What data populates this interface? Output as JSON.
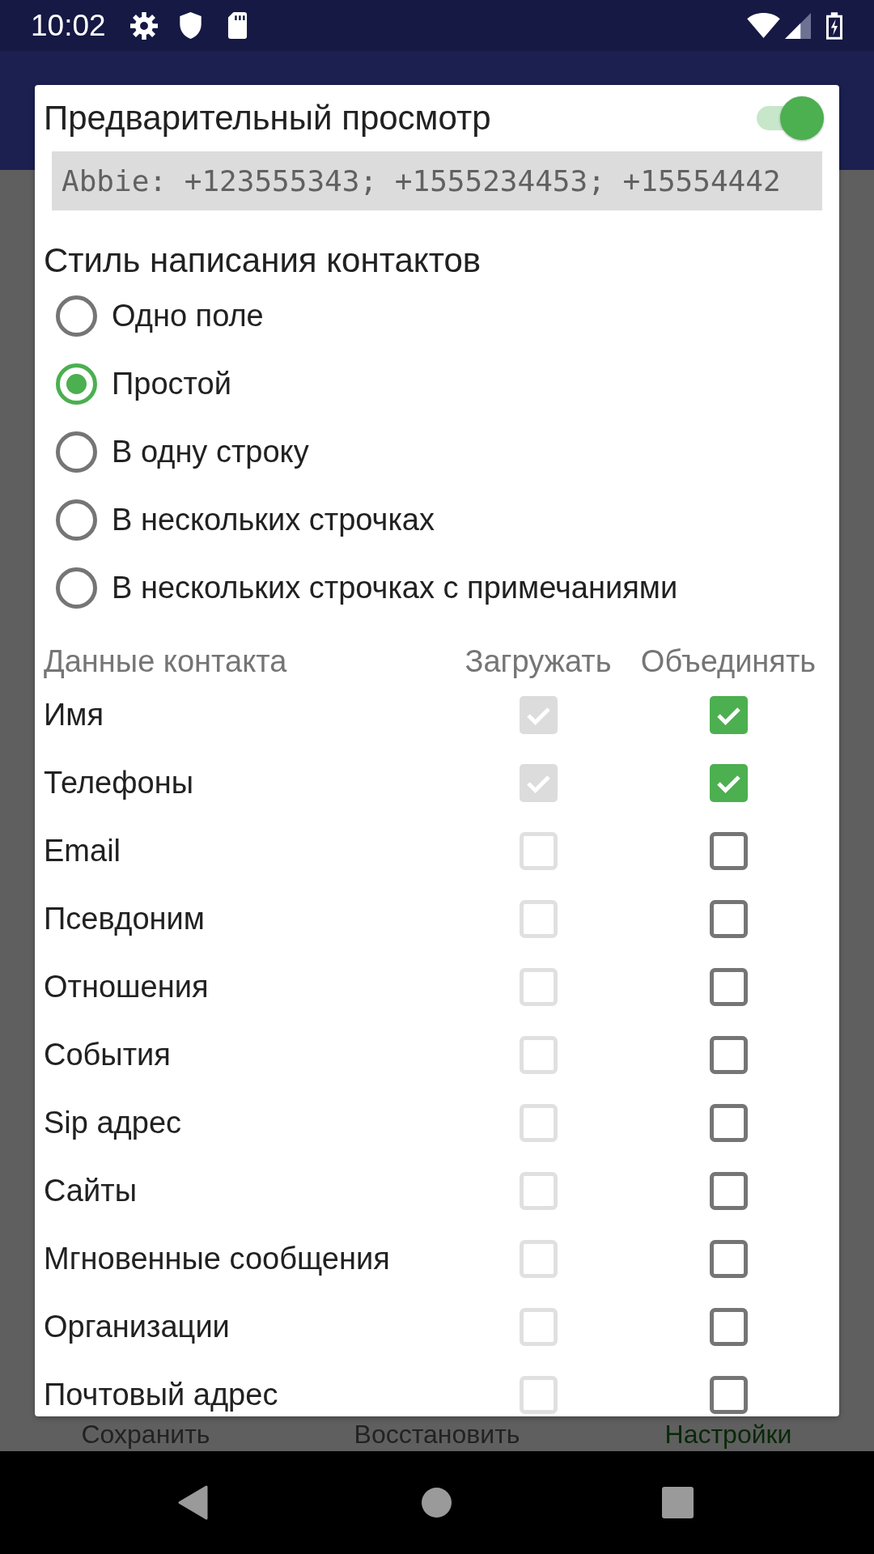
{
  "status_bar": {
    "time": "10:02"
  },
  "dialog": {
    "preview": {
      "title": "Предварительный просмотр",
      "on": true,
      "sample": "Abbie: +123555343; +1555234453; +15554442"
    },
    "style": {
      "title": "Стиль написания контактов",
      "options": [
        {
          "label": "Одно поле",
          "selected": false
        },
        {
          "label": "Простой",
          "selected": true
        },
        {
          "label": "В одну строку",
          "selected": false
        },
        {
          "label": "В нескольких строчках",
          "selected": false
        },
        {
          "label": "В нескольких строчках с примечаниями",
          "selected": false
        }
      ]
    },
    "fields": {
      "columns": [
        "Данные контакта",
        "Загружать",
        "Объединять"
      ],
      "rows": [
        {
          "name": "Имя",
          "load": {
            "checked": true,
            "disabled": true
          },
          "merge": {
            "checked": true,
            "disabled": false
          }
        },
        {
          "name": "Телефоны",
          "load": {
            "checked": true,
            "disabled": true
          },
          "merge": {
            "checked": true,
            "disabled": false
          }
        },
        {
          "name": "Email",
          "load": {
            "checked": false,
            "disabled": true
          },
          "merge": {
            "checked": false,
            "disabled": false
          }
        },
        {
          "name": "Псевдоним",
          "load": {
            "checked": false,
            "disabled": true
          },
          "merge": {
            "checked": false,
            "disabled": false
          }
        },
        {
          "name": "Отношения",
          "load": {
            "checked": false,
            "disabled": true
          },
          "merge": {
            "checked": false,
            "disabled": false
          }
        },
        {
          "name": "События",
          "load": {
            "checked": false,
            "disabled": true
          },
          "merge": {
            "checked": false,
            "disabled": false
          }
        },
        {
          "name": "Sip адрес",
          "load": {
            "checked": false,
            "disabled": true
          },
          "merge": {
            "checked": false,
            "disabled": false
          }
        },
        {
          "name": "Сайты",
          "load": {
            "checked": false,
            "disabled": true
          },
          "merge": {
            "checked": false,
            "disabled": false
          }
        },
        {
          "name": "Мгновенные сообщения",
          "load": {
            "checked": false,
            "disabled": true
          },
          "merge": {
            "checked": false,
            "disabled": false
          }
        },
        {
          "name": "Организации",
          "load": {
            "checked": false,
            "disabled": true
          },
          "merge": {
            "checked": false,
            "disabled": false
          }
        },
        {
          "name": "Почтовый адрес",
          "load": {
            "checked": false,
            "disabled": true
          },
          "merge": {
            "checked": false,
            "disabled": false
          }
        }
      ]
    }
  },
  "bottom_bar": {
    "buttons": [
      {
        "label": "Сохранить",
        "selected": false
      },
      {
        "label": "Восстановить",
        "selected": false
      },
      {
        "label": "Настройки",
        "selected": true
      }
    ]
  }
}
